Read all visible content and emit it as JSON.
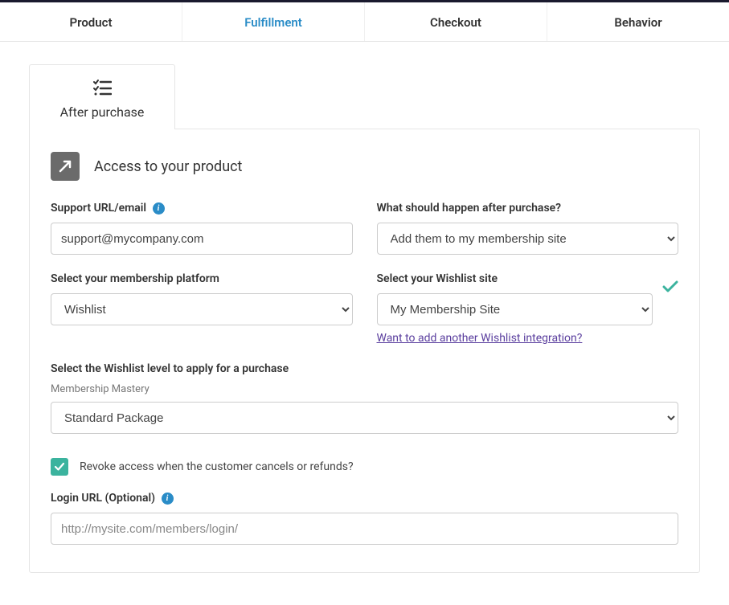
{
  "tabs": {
    "product": "Product",
    "fulfillment": "Fulfillment",
    "checkout": "Checkout",
    "behavior": "Behavior"
  },
  "subTab": {
    "label": "After purchase"
  },
  "section": {
    "title": "Access to your product"
  },
  "fields": {
    "support": {
      "label": "Support URL/email",
      "value": "support@mycompany.com"
    },
    "afterPurchase": {
      "label": "What should happen after purchase?",
      "value": "Add them to my membership site"
    },
    "platform": {
      "label": "Select your membership platform",
      "value": "Wishlist"
    },
    "wishlistSite": {
      "label": "Select your Wishlist site",
      "value": "My Membership Site",
      "addLink": "Want to add another Wishlist integration?"
    },
    "wishlistLevel": {
      "label": "Select the Wishlist level to apply for a purchase",
      "sub": "Membership Mastery",
      "value": "Standard Package"
    },
    "revoke": {
      "label": "Revoke access when the customer cancels or refunds?",
      "checked": true
    },
    "loginUrl": {
      "label": "Login URL (Optional)",
      "placeholder": "http://mysite.com/members/login/",
      "value": ""
    }
  },
  "colors": {
    "accent": "#2a8cc7",
    "success": "#3bb39e",
    "link": "#5a3e9e"
  }
}
